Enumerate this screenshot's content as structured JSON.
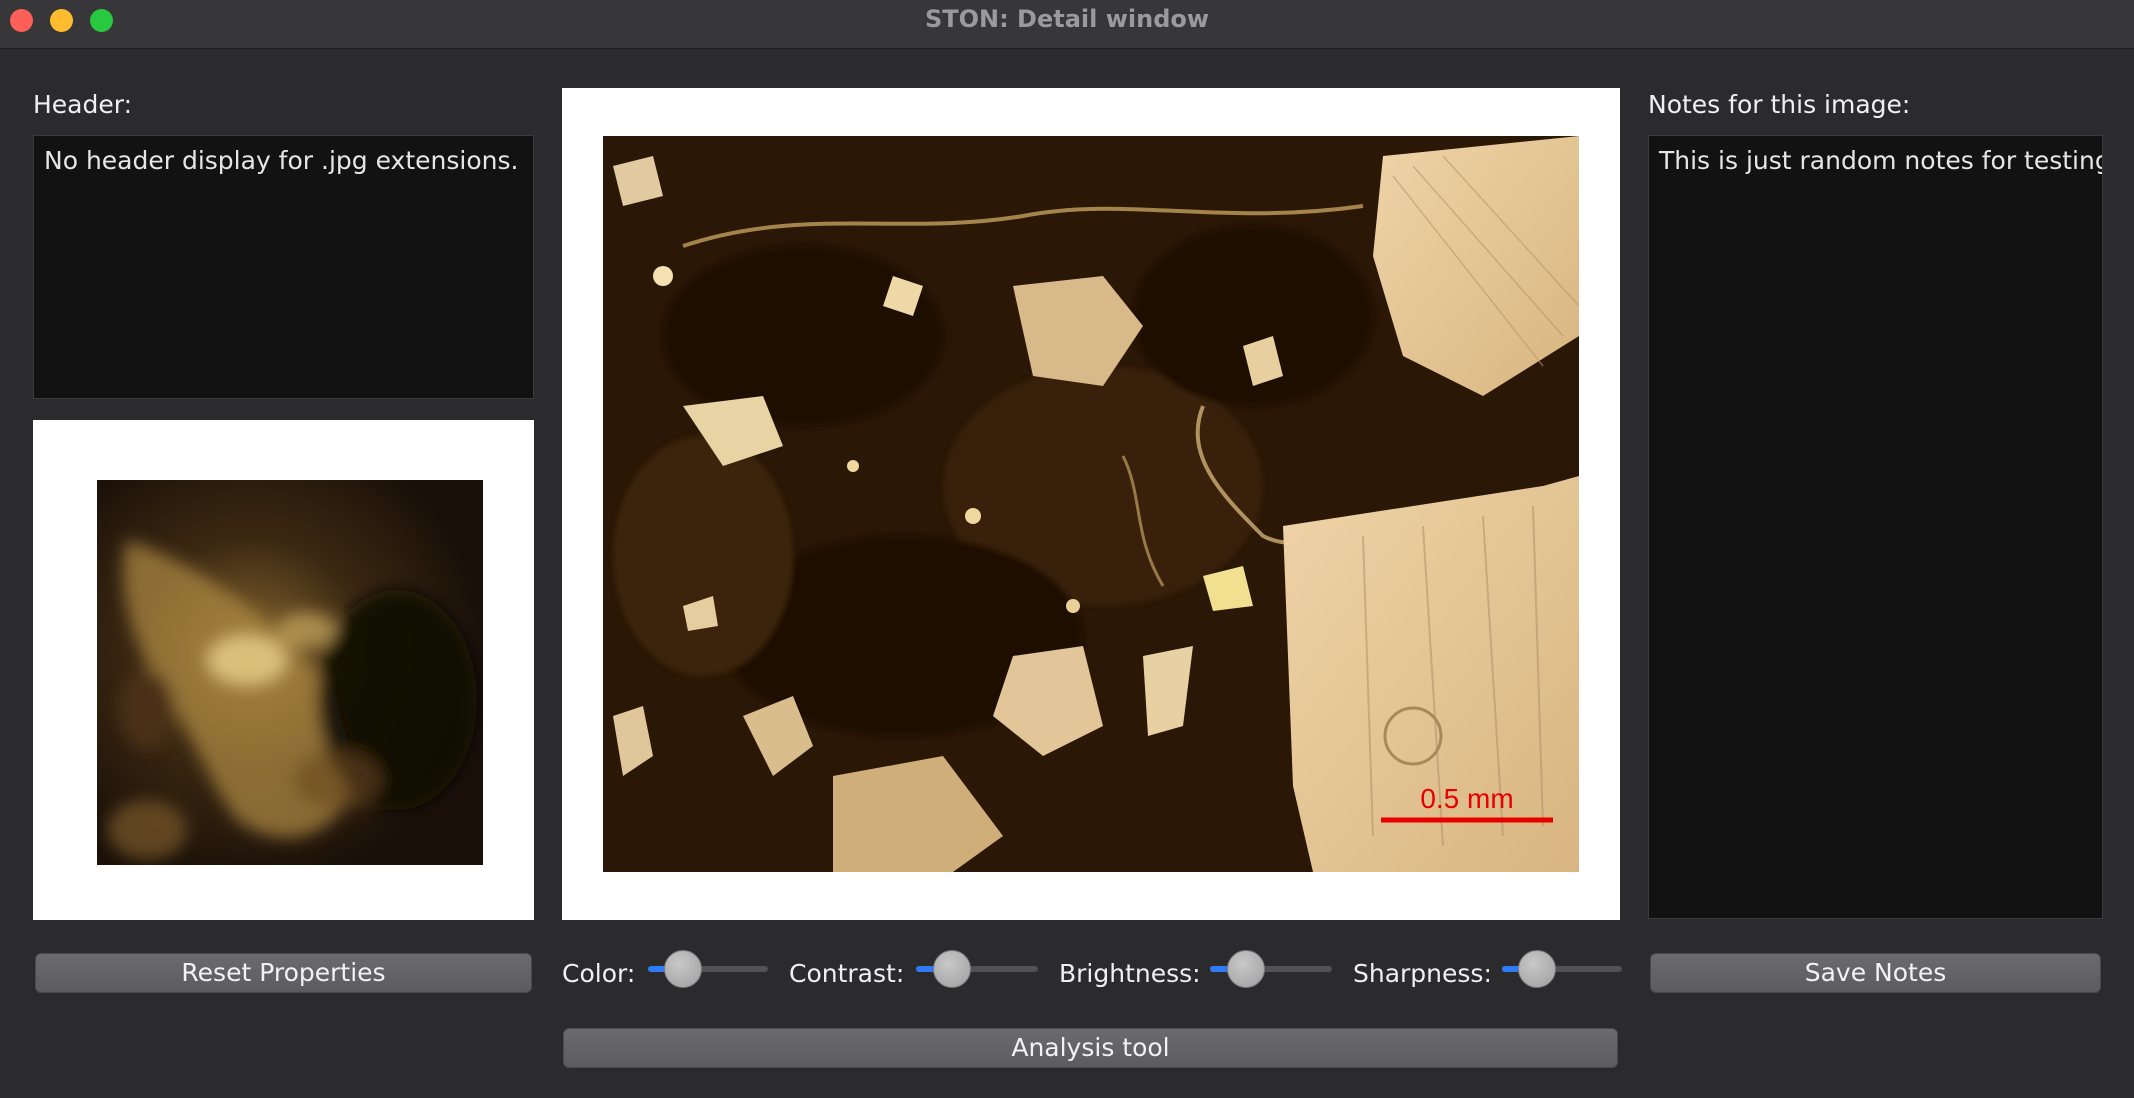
{
  "window": {
    "title": "STON: Detail window"
  },
  "header_section": {
    "label": "Header:",
    "text": "No header display for .jpg extensions."
  },
  "notes_section": {
    "label": "Notes for this image:",
    "text": "This is just random notes for testing"
  },
  "main_image": {
    "scale_bar_label": "0.5 mm",
    "scale_bar_color": "#e60000"
  },
  "buttons": {
    "reset": "Reset Properties",
    "save": "Save Notes",
    "analysis": "Analysis tool"
  },
  "sliders": {
    "color": {
      "label": "Color:",
      "value": 0.3
    },
    "contrast": {
      "label": "Contrast:",
      "value": 0.3
    },
    "brightness": {
      "label": "Brightness:",
      "value": 0.3
    },
    "sharpness": {
      "label": "Sharpness:",
      "value": 0.3
    }
  },
  "colors": {
    "accent": "#2f7bf5",
    "background": "#2b2b2d"
  }
}
